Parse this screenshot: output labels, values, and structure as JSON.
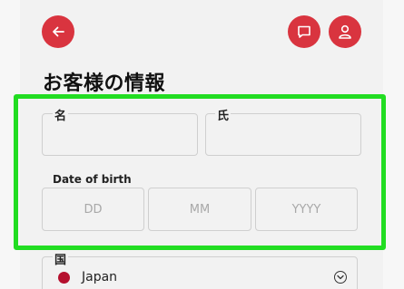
{
  "header": {
    "back_icon": "arrow-left-icon",
    "chat_icon": "chat-bubble-icon",
    "user_icon": "user-icon",
    "accent_color": "#d9343f"
  },
  "page": {
    "title": "お客様の情報"
  },
  "form": {
    "first_name_label": "名",
    "last_name_label": "氏",
    "first_name_value": "",
    "last_name_value": "",
    "dob": {
      "label": "Date of birth",
      "day_placeholder": "DD",
      "month_placeholder": "MM",
      "year_placeholder": "YYYY"
    },
    "country": {
      "label": "国",
      "selected": "Japan",
      "flag_color": "#b5102e"
    }
  },
  "highlight_color": "#22dd22"
}
